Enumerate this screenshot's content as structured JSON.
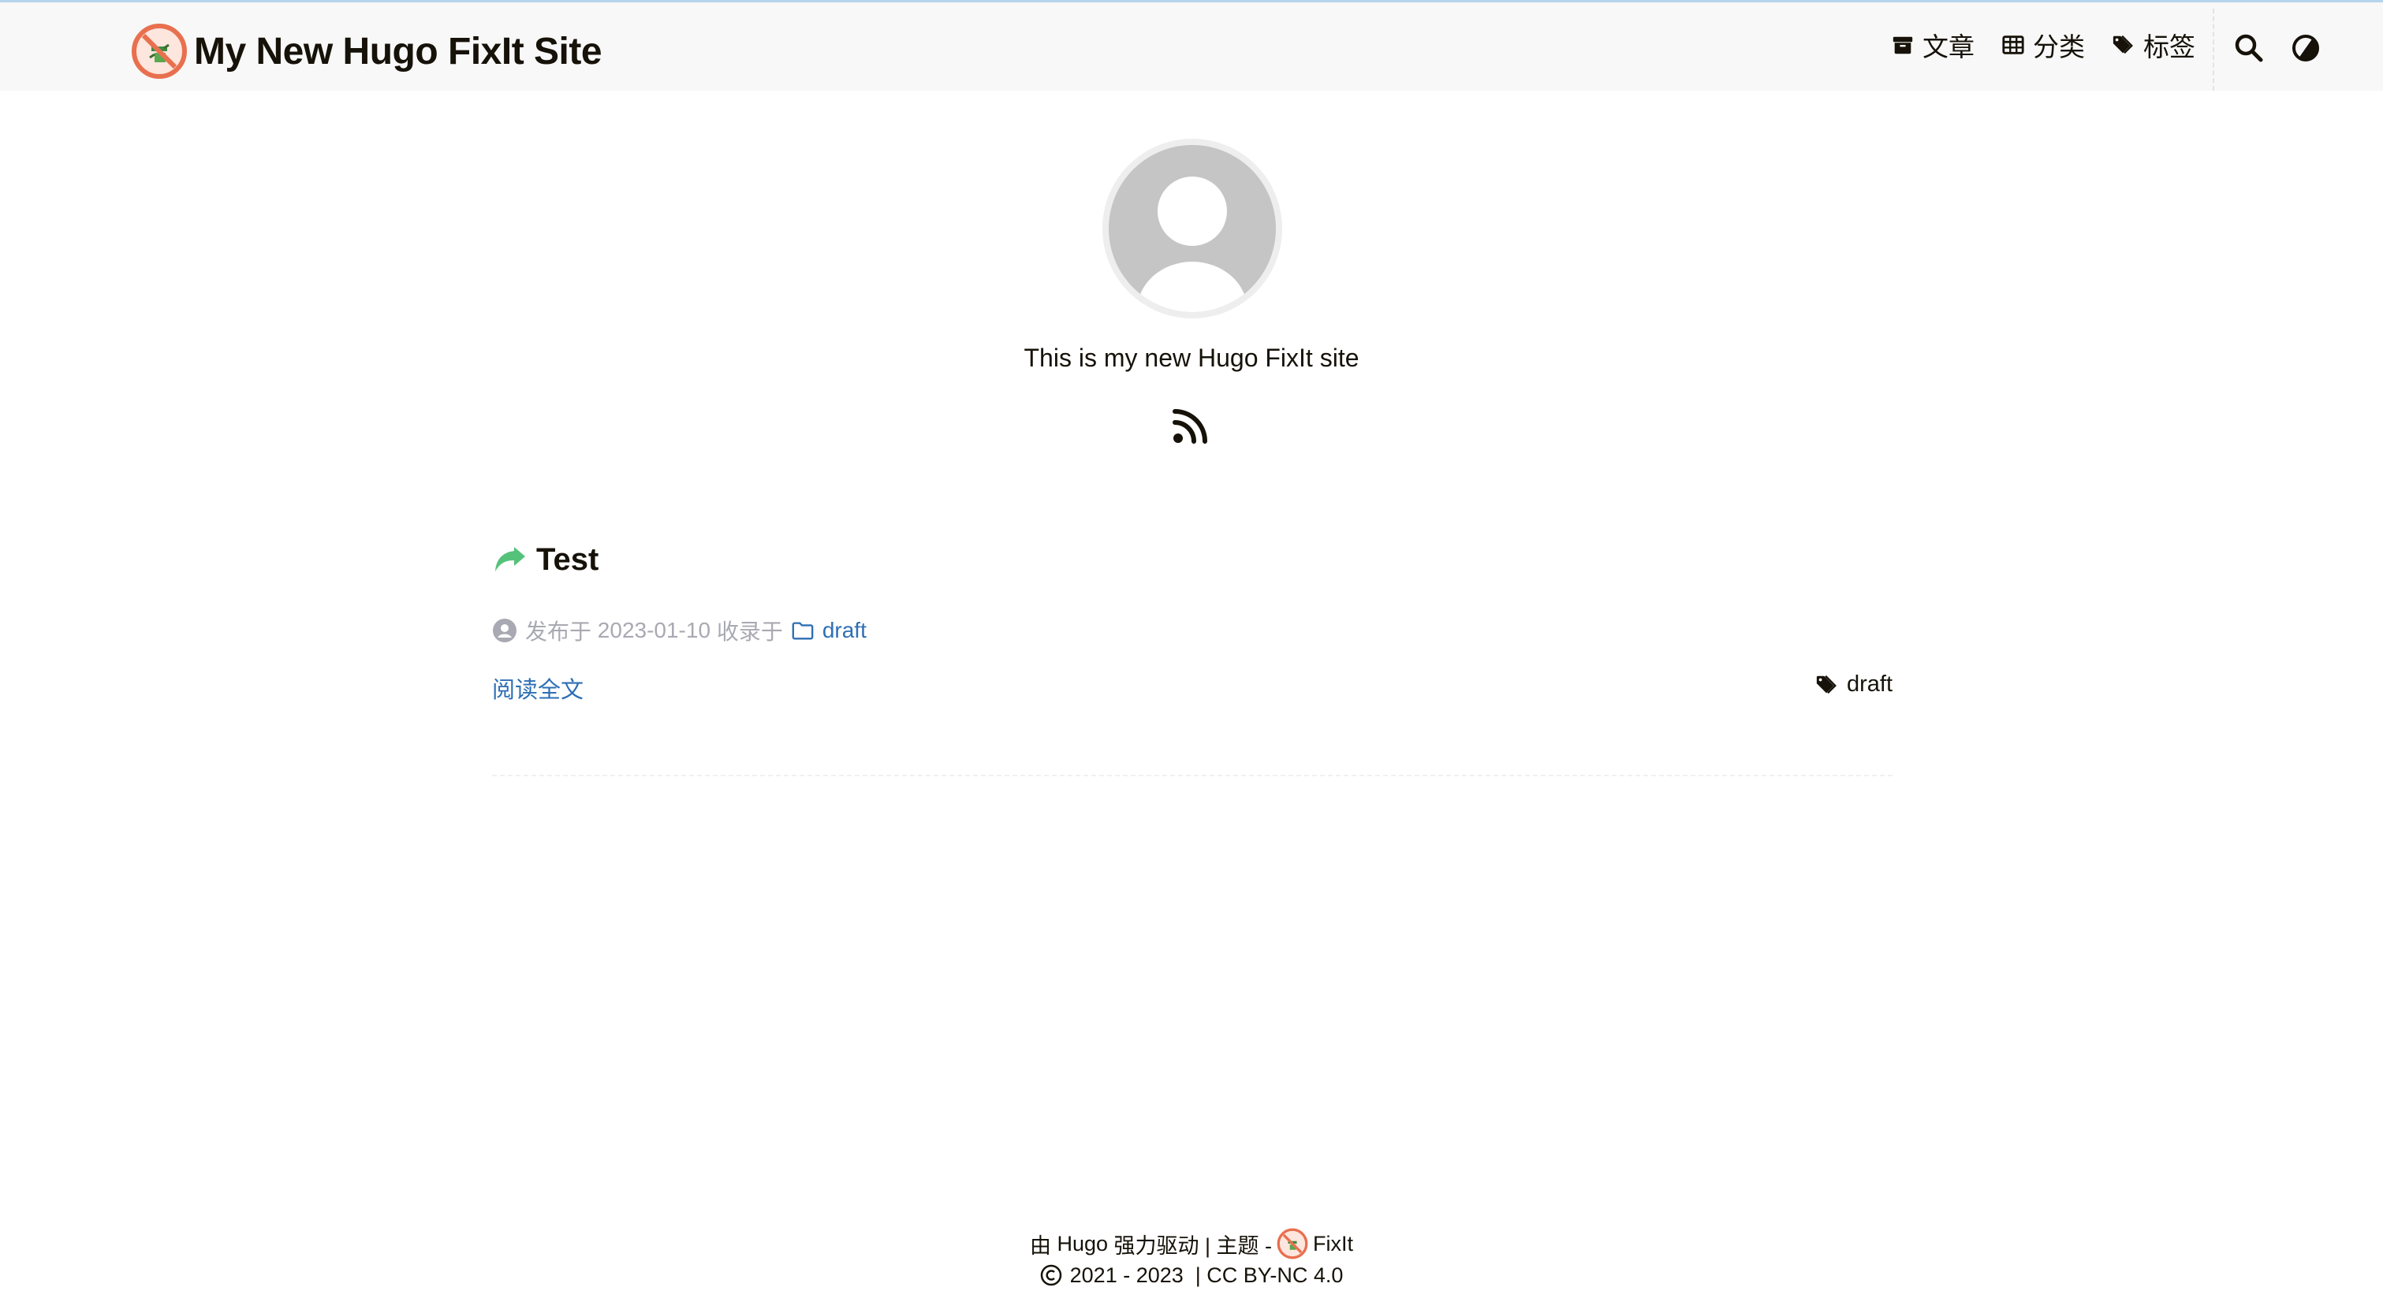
{
  "header": {
    "site_title": "My New Hugo FixIt Site",
    "nav": {
      "posts": "文章",
      "categories": "分类",
      "tags": "标签"
    }
  },
  "profile": {
    "subtitle": "This is my new Hugo FixIt site"
  },
  "post": {
    "title": "Test",
    "published_prefix": "发布于",
    "date": "2023-01-10",
    "collected_in": "收录于",
    "category": "draft",
    "read_more": "阅读全文",
    "tag": "draft"
  },
  "footer": {
    "line1_prefix": "由",
    "hugo": "Hugo",
    "line1_mid": "强力驱动 | 主题 -",
    "theme": "FixIt",
    "years": "2021 - 2023",
    "license": "| CC BY-NC 4.0"
  },
  "colors": {
    "accent_link": "#2d6fb4",
    "share_icon_green": "#55c27a",
    "header_bg": "#f8f8f8",
    "meta_gray": "#a9a9b3"
  },
  "icons": {
    "logo": "fixit-logo-icon",
    "posts": "archive-icon",
    "categories": "table-grid-icon",
    "tags": "tags-icon",
    "search": "search-icon",
    "theme": "theme-toggle-icon",
    "rss": "rss-icon",
    "post_type": "share-arrow-icon",
    "author": "user-circle-icon",
    "category": "folder-icon",
    "tag": "tags-icon",
    "copyright": "copyright-icon"
  }
}
